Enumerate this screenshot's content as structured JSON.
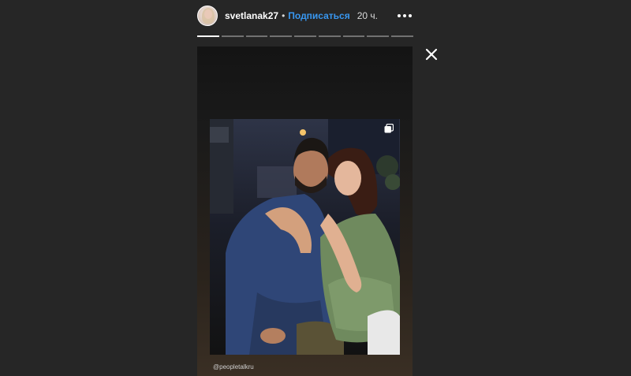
{
  "story": {
    "username": "svetlanak27",
    "separator": "•",
    "follow_label": "Подписаться",
    "time": "20 ч.",
    "more_icon": "more-horizontal-icon",
    "close_icon": "close-icon",
    "progress": {
      "segment_count": 9,
      "current_index": 0,
      "current_fraction": 1.0
    },
    "credit": "@peopletalkru",
    "repost_icon": "carousel-icon"
  },
  "colors": {
    "background": "#262626",
    "accent_link": "#3897f0",
    "text": "#ffffff"
  }
}
